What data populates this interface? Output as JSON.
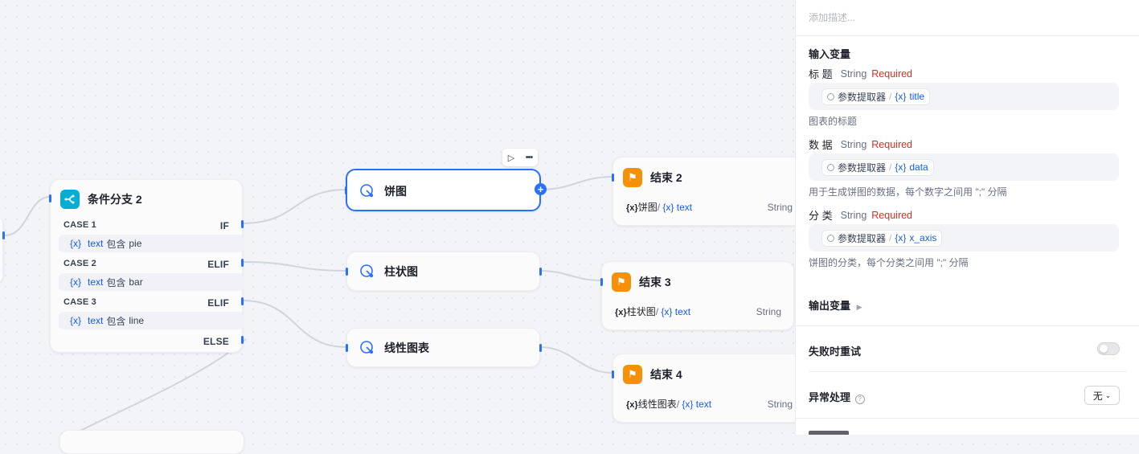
{
  "canvas": {
    "branch_node": {
      "title": "条件分支 2",
      "cases": [
        {
          "label": "CASE 1",
          "keyword": "IF",
          "var_icon": "{x}",
          "var": "text",
          "op": "包含",
          "value": "pie"
        },
        {
          "label": "CASE 2",
          "keyword": "ELIF",
          "var_icon": "{x}",
          "var": "text",
          "op": "包含",
          "value": "bar"
        },
        {
          "label": "CASE 3",
          "keyword": "ELIF",
          "var_icon": "{x}",
          "var": "text",
          "op": "包含",
          "value": "line"
        }
      ],
      "else_label": "ELSE"
    },
    "tool_nodes": [
      {
        "title": "饼图"
      },
      {
        "title": "柱状图"
      },
      {
        "title": "线性图表"
      }
    ],
    "end_nodes": [
      {
        "title": "结束 2",
        "src_icon": "{x}",
        "src": "饼图",
        "var_icon": "{x}",
        "var": "text",
        "type": "String"
      },
      {
        "title": "结束 3",
        "src_icon": "{x}",
        "src": "柱状图",
        "var_icon": "{x}",
        "var": "text",
        "type": "String"
      },
      {
        "title": "结束 4",
        "src_icon": "{x}",
        "src": "线性图表",
        "var_icon": "{x}",
        "var": "text",
        "type": "String"
      }
    ],
    "toolbar": {
      "run_icon": "▷",
      "more_icon": "•••"
    }
  },
  "panel": {
    "description_placeholder": "添加描述...",
    "inputs_title": "输入变量",
    "params": [
      {
        "name": "标 题",
        "type": "String",
        "required": "Required",
        "source": "参数提取器",
        "var_icon": "{x}",
        "var": "title",
        "hint": "图表的标题"
      },
      {
        "name": "数 据",
        "type": "String",
        "required": "Required",
        "source": "参数提取器",
        "var_icon": "{x}",
        "var": "data",
        "hint": "用于生成饼图的数据，每个数字之间用 \";\" 分隔"
      },
      {
        "name": "分 类",
        "type": "String",
        "required": "Required",
        "source": "参数提取器",
        "var_icon": "{x}",
        "var": "x_axis",
        "hint": "饼图的分类，每个分类之间用 \";\" 分隔"
      }
    ],
    "outputs_title": "输出变量",
    "retry_label": "失败时重试",
    "error_label": "异常处理",
    "error_select": "无"
  },
  "colors": {
    "accent": "#2970ff",
    "branch_icon": "#06aed4",
    "end_icon": "#f79009",
    "required": "#d92d20"
  }
}
